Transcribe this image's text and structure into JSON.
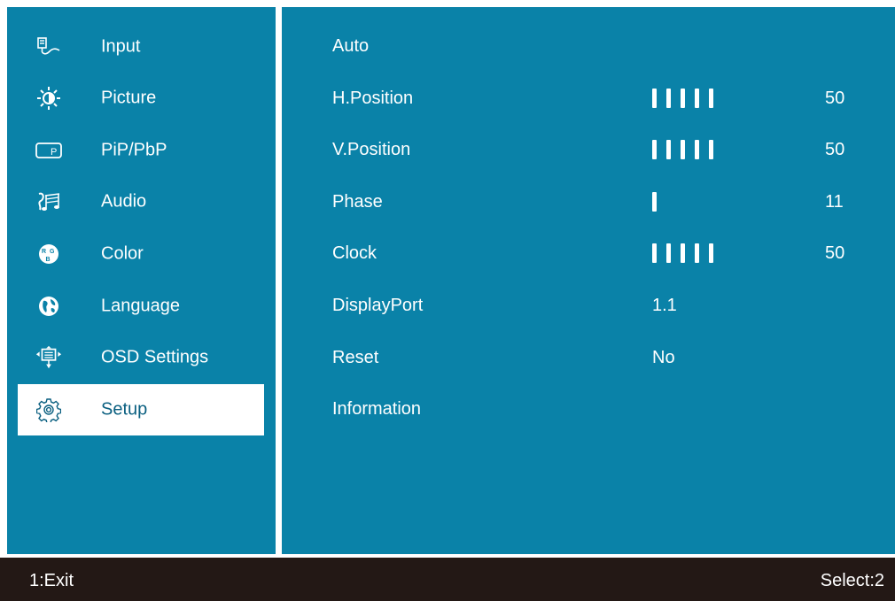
{
  "sidebar": {
    "items": [
      {
        "label": "Input",
        "icon": "input-icon",
        "selected": false
      },
      {
        "label": "Picture",
        "icon": "brightness-icon",
        "selected": false
      },
      {
        "label": "PiP/PbP",
        "icon": "pip-icon",
        "selected": false
      },
      {
        "label": "Audio",
        "icon": "audio-icon",
        "selected": false
      },
      {
        "label": "Color",
        "icon": "rgb-icon",
        "selected": false
      },
      {
        "label": "Language",
        "icon": "globe-icon",
        "selected": false
      },
      {
        "label": "OSD Settings",
        "icon": "osd-icon",
        "selected": false
      },
      {
        "label": "Setup",
        "icon": "gear-icon",
        "selected": true
      }
    ]
  },
  "main": {
    "rows": [
      {
        "label": "Auto"
      },
      {
        "label": "H.Position",
        "level": 50,
        "value": "50"
      },
      {
        "label": "V.Position",
        "level": 50,
        "value": "50"
      },
      {
        "label": "Phase",
        "level": 11,
        "value": "11"
      },
      {
        "label": "Clock",
        "level": 50,
        "value": "50"
      },
      {
        "label": "DisplayPort",
        "text": "1.1"
      },
      {
        "label": "Reset",
        "text": "No"
      },
      {
        "label": "Information"
      }
    ]
  },
  "footer": {
    "left": "1:Exit",
    "right": "Select:2"
  },
  "colors": {
    "panel": "#0a82a8",
    "footer": "#231815",
    "selected_text": "#0a5f80"
  }
}
